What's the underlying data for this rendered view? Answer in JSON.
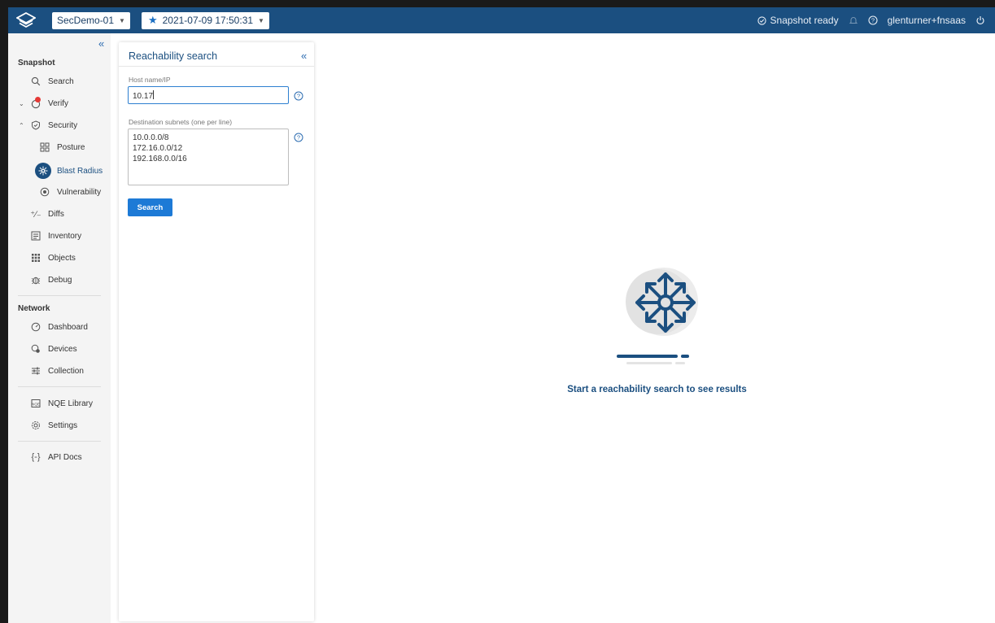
{
  "topbar": {
    "network_name": "SecDemo-01",
    "snapshot_time": "2021-07-09 17:50:31",
    "status_text": "Snapshot ready",
    "user": "glenturner+fnsaas"
  },
  "sidebar": {
    "section_snapshot": "Snapshot",
    "section_network": "Network",
    "items": {
      "search": "Search",
      "verify": "Verify",
      "security": "Security",
      "posture": "Posture",
      "blast_radius": "Blast Radius",
      "vulnerability": "Vulnerability",
      "diffs": "Diffs",
      "inventory": "Inventory",
      "objects": "Objects",
      "debug": "Debug",
      "dashboard": "Dashboard",
      "devices": "Devices",
      "collection": "Collection",
      "nqe_library": "NQE Library",
      "settings": "Settings",
      "api_docs": "API Docs"
    }
  },
  "panel": {
    "title": "Reachability search",
    "host_label": "Host name/IP",
    "host_value": "10.17",
    "subnets_label": "Destination subnets (one per line)",
    "subnets": [
      "10.0.0.0/8",
      "172.16.0.0/12",
      "192.168.0.0/16"
    ],
    "search_button": "Search"
  },
  "main": {
    "empty_message": "Start a reachability search to see results"
  },
  "colors": {
    "topbar": "#1b4f80",
    "accent": "#1d7ad6",
    "sidebar_bg": "#f4f4f4"
  }
}
